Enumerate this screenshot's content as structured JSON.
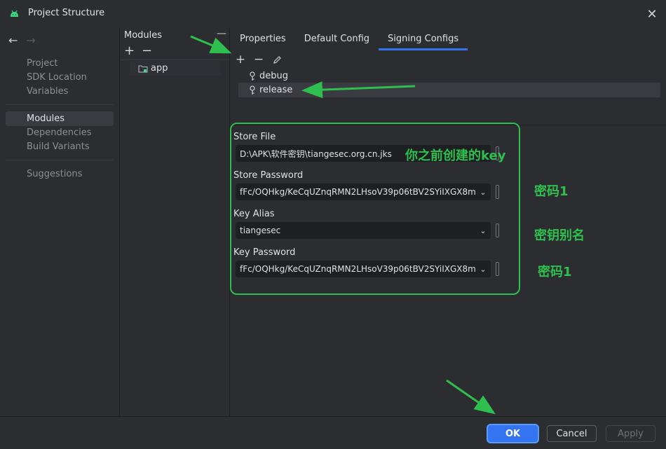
{
  "window": {
    "title": "Project Structure"
  },
  "sidebar": {
    "items": [
      {
        "label": "Project"
      },
      {
        "label": "SDK Location"
      },
      {
        "label": "Variables"
      },
      {
        "label": "Modules"
      },
      {
        "label": "Dependencies"
      },
      {
        "label": "Build Variants"
      },
      {
        "label": "Suggestions"
      }
    ]
  },
  "modules": {
    "title": "Modules",
    "items": [
      {
        "label": "app"
      }
    ]
  },
  "tabs": [
    {
      "label": "Properties"
    },
    {
      "label": "Default Config"
    },
    {
      "label": "Signing Configs"
    }
  ],
  "signing_configs": [
    {
      "label": "debug"
    },
    {
      "label": "release"
    }
  ],
  "form": {
    "store_file": {
      "label": "Store File",
      "value": "D:\\APK\\软件密钥\\tiangesec.org.cn.jks"
    },
    "store_password": {
      "label": "Store Password",
      "value": "fFc/OQHkg/KeCqUZnqRMN2LHsoV39p06tBV2SYiIXGX8m"
    },
    "key_alias": {
      "label": "Key Alias",
      "value": "tiangesec"
    },
    "key_password": {
      "label": "Key Password",
      "value": "fFc/OQHkg/KeCqUZnqRMN2LHsoV39p06tBV2SYiIXGX8m"
    }
  },
  "annotations": {
    "store_file_note": "你之前创建的key",
    "store_password_note": "密码1",
    "key_alias_note": "密钥别名",
    "key_password_note": "密码1"
  },
  "footer": {
    "ok": "OK",
    "cancel": "Cancel",
    "apply": "Apply"
  },
  "colors": {
    "accent": "#3574f0",
    "annotation_green": "#2fbf4e",
    "background": "#2b2d30"
  }
}
